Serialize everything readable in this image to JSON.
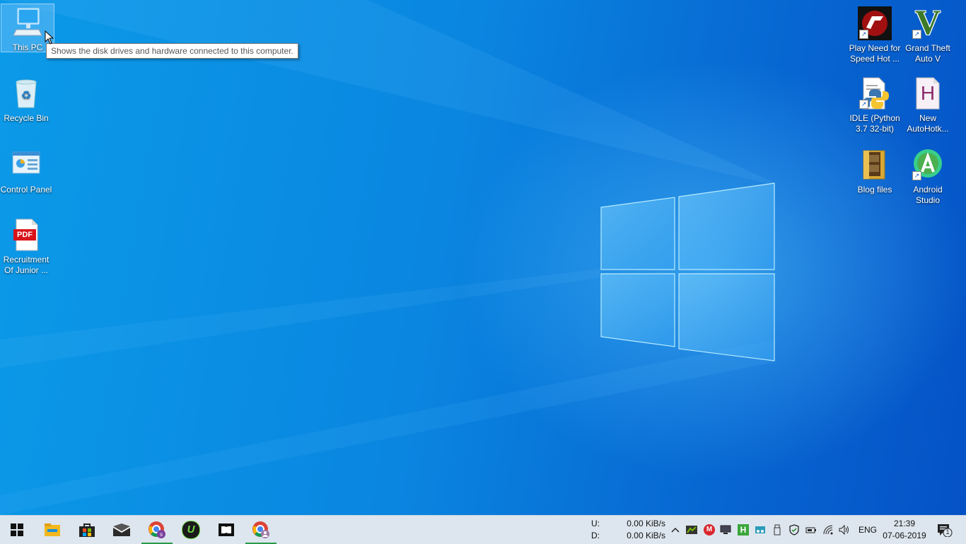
{
  "desktop": {
    "left_icons": [
      {
        "label": "This PC"
      },
      {
        "label": "Recycle Bin"
      },
      {
        "label": "Control Panel"
      },
      {
        "label": "Recruitment Of Junior ..."
      }
    ],
    "right_icons": [
      {
        "label": "Play Need for Speed Hot ..."
      },
      {
        "label": "Grand Theft Auto V"
      },
      {
        "label": "IDLE (Python 3.7 32-bit)"
      },
      {
        "label": "New AutoHotk..."
      },
      {
        "label": "Blog files"
      },
      {
        "label": "Android Studio"
      }
    ],
    "pdf_badge": "PDF",
    "autohotkey_letter": "H",
    "gta_letter": "V",
    "tooltip": "Shows the disk drives and hardware connected to this computer."
  },
  "taskbar": {
    "apps": [
      {
        "icon": "windows-start-icon"
      },
      {
        "icon": "file-explorer-icon"
      },
      {
        "icon": "microsoft-store-icon"
      },
      {
        "icon": "mail-icon"
      },
      {
        "icon": "chrome-profile-s-icon"
      },
      {
        "icon": "upwork-icon"
      },
      {
        "icon": "dolby-icon"
      },
      {
        "icon": "chrome-profile-icon"
      }
    ],
    "upwork_letter": "U",
    "net_speed": {
      "upload_label": "U:",
      "download_label": "D:",
      "upload_value": "0.00 KiB/s",
      "download_value": "0.00 KiB/s"
    },
    "language": "ENG",
    "time": "21:39",
    "date": "07-06-2019",
    "notification_count": "1",
    "tray_m_letter": "M",
    "tray_h_letter": "H"
  },
  "colors": {
    "wallpaper_blue": "#0a86e0",
    "taskbar_bg": "#dde6ee",
    "active_indicator": "#2a9a4a"
  }
}
